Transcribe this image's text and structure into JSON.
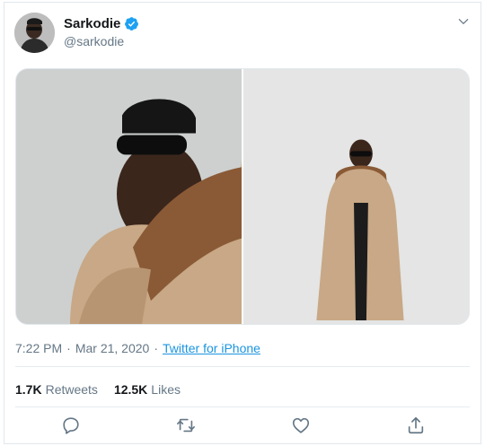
{
  "tweet": {
    "author": {
      "display_name": "Sarkodie",
      "handle": "@sarkodie",
      "verified": true,
      "avatar_icon": "avatar-photo"
    },
    "menu_icon": "chevron-down-icon",
    "media": {
      "count": 2,
      "photos": [
        "photo-closeup",
        "photo-full-length"
      ]
    },
    "timestamp": "7:22 PM · Mar 21, 2020",
    "time": "7:22 PM",
    "date": "Mar 21, 2020",
    "separator": "·",
    "source": "Twitter for iPhone",
    "stats": {
      "retweets_count": "1.7K",
      "retweets_label": "Retweets",
      "likes_count": "12.5K",
      "likes_label": "Likes"
    },
    "actions": [
      "reply-icon",
      "retweet-icon",
      "like-icon",
      "share-icon"
    ]
  },
  "colors": {
    "text_primary": "#14171a",
    "text_secondary": "#657786",
    "link": "#1b95e0",
    "verified": "#1da1f2",
    "border": "#e1e8ed"
  }
}
